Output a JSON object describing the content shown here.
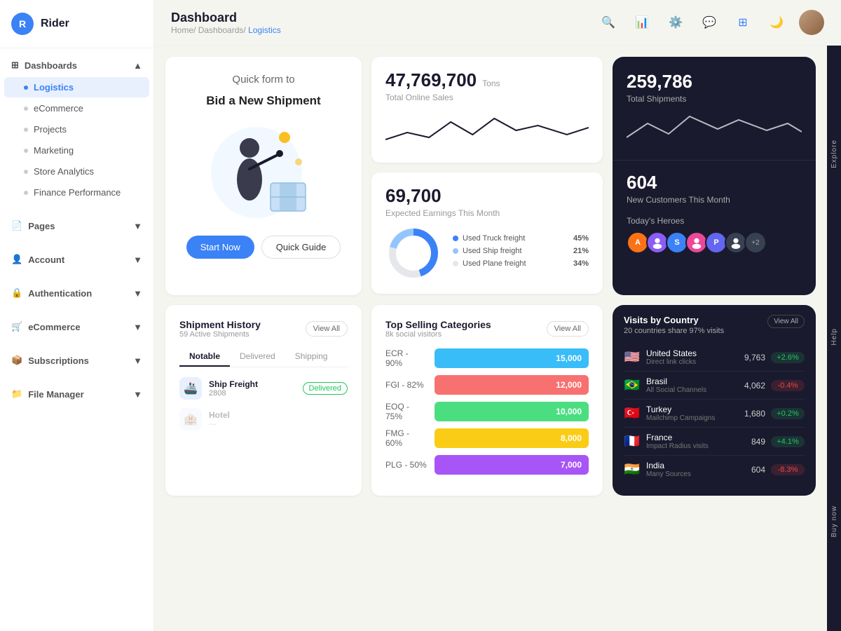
{
  "app": {
    "logo_letter": "R",
    "logo_name": "Rider"
  },
  "sidebar": {
    "dashboards_label": "Dashboards",
    "items": [
      {
        "id": "logistics",
        "label": "Logistics",
        "active": true
      },
      {
        "id": "ecommerce",
        "label": "eCommerce",
        "active": false
      },
      {
        "id": "projects",
        "label": "Projects",
        "active": false
      },
      {
        "id": "marketing",
        "label": "Marketing",
        "active": false
      },
      {
        "id": "store-analytics",
        "label": "Store Analytics",
        "active": false
      },
      {
        "id": "finance-performance",
        "label": "Finance Performance",
        "active": false
      }
    ],
    "pages_label": "Pages",
    "account_label": "Account",
    "authentication_label": "Authentication",
    "ecommerce_label": "eCommerce",
    "subscriptions_label": "Subscriptions",
    "file_manager_label": "File Manager"
  },
  "header": {
    "title": "Dashboard",
    "breadcrumb": [
      "Home",
      "Dashboards",
      "Logistics"
    ]
  },
  "promo": {
    "title": "Quick form to",
    "subtitle": "Bid a New Shipment",
    "btn_start": "Start Now",
    "btn_guide": "Quick Guide"
  },
  "stats": {
    "total_online_sales_value": "47,769,700",
    "total_online_sales_unit": "Tons",
    "total_online_sales_label": "Total Online Sales",
    "total_shipments_value": "259,786",
    "total_shipments_label": "Total Shipments",
    "expected_earnings_value": "69,700",
    "expected_earnings_label": "Expected Earnings This Month",
    "new_customers_value": "604",
    "new_customers_label": "New Customers This Month"
  },
  "freight": {
    "truck_label": "Used Truck freight",
    "truck_pct": "45%",
    "ship_label": "Used Ship freight",
    "ship_pct": "21%",
    "plane_label": "Used Plane freight",
    "plane_pct": "34%"
  },
  "heroes": {
    "title": "Today's Heroes",
    "count_label": "+2"
  },
  "shipment_history": {
    "title": "Shipment History",
    "subtitle": "59 Active Shipments",
    "view_all": "View All",
    "tabs": [
      "Notable",
      "Delivered",
      "Shipping"
    ],
    "active_tab": "Notable",
    "rows": [
      {
        "icon": "🚢",
        "name": "Ship Freight",
        "num": "2808",
        "status": "Delivered"
      }
    ]
  },
  "top_selling": {
    "title": "Top Selling Categories",
    "subtitle": "8k social visitors",
    "view_all": "View All",
    "bars": [
      {
        "label": "ECR - 90%",
        "value": "15,000",
        "color": "#38bdf8",
        "width": "85%"
      },
      {
        "label": "FGI - 82%",
        "value": "12,000",
        "color": "#f87171",
        "width": "70%"
      },
      {
        "label": "EOQ - 75%",
        "value": "10,000",
        "color": "#4ade80",
        "width": "60%"
      },
      {
        "label": "FMG - 60%",
        "value": "8,000",
        "color": "#facc15",
        "width": "48%"
      },
      {
        "label": "PLG - 50%",
        "value": "7,000",
        "color": "#a855f7",
        "width": "42%"
      }
    ]
  },
  "visits": {
    "title": "Visits by Country",
    "subtitle": "20 countries share 97% visits",
    "view_all": "View All",
    "countries": [
      {
        "flag": "🇺🇸",
        "name": "United States",
        "source": "Direct link clicks",
        "visits": "9,763",
        "change": "+2.6%",
        "up": true
      },
      {
        "flag": "🇧🇷",
        "name": "Brasil",
        "source": "All Social Channels",
        "visits": "4,062",
        "change": "-0.4%",
        "up": false
      },
      {
        "flag": "🇹🇷",
        "name": "Turkey",
        "source": "Mailchimp Campaigns",
        "visits": "1,680",
        "change": "+0.2%",
        "up": true
      },
      {
        "flag": "🇫🇷",
        "name": "France",
        "source": "Impact Radius visits",
        "visits": "849",
        "change": "+4.1%",
        "up": true
      },
      {
        "flag": "🇮🇳",
        "name": "India",
        "source": "Many Sources",
        "visits": "604",
        "change": "-8.3%",
        "up": false
      }
    ]
  },
  "side_labels": [
    "Explore",
    "Help",
    "Buy now"
  ]
}
